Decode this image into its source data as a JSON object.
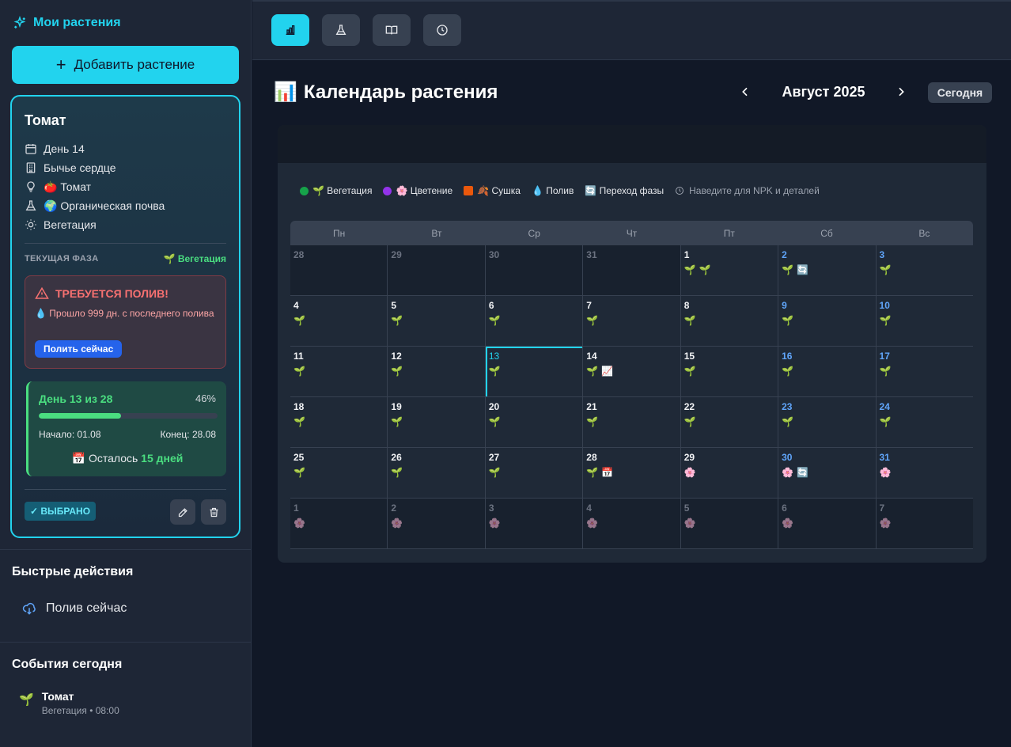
{
  "sidebar": {
    "brand": "Мои растения",
    "add_button": "Добавить растение",
    "plant": {
      "name": "Томат",
      "info": [
        {
          "icon": "calendar-icon",
          "text": "День 14"
        },
        {
          "icon": "building-icon",
          "text": "Бычье сердце"
        },
        {
          "icon": "lightbulb-icon",
          "text": "🍅 Томат"
        },
        {
          "icon": "flask-icon",
          "text": "🌍 Органическая почва"
        },
        {
          "icon": "sun-icon",
          "text": "Вегетация"
        }
      ],
      "phase_label": "ТЕКУЩАЯ ФАЗА",
      "phase_value": "🌱 Вегетация",
      "alert": {
        "title": "ТРЕБУЕТСЯ ПОЛИВ!",
        "text": "💧 Прошло 999 дн. с последнего полива",
        "button": "Полить сейчас"
      },
      "progress": {
        "day_text": "День 13 из 28",
        "percent_text": "46%",
        "percent": 46,
        "start": "Начало: 01.08",
        "end": "Конец: 28.08",
        "remaining_prefix": "Осталось",
        "remaining_value": "15 дней"
      },
      "selected_badge": "✓ ВЫБРАНО"
    },
    "quick_actions_title": "Быстрые действия",
    "quick_action": "Полив сейчас",
    "events_title": "События сегодня",
    "event": {
      "title": "Томат",
      "subtitle": "Вегетация • 08:00"
    }
  },
  "main": {
    "title": "Календарь растения",
    "month": "Август 2025",
    "today_button": "Сегодня",
    "legend": [
      {
        "color": "#16a34a",
        "shape": "dot",
        "label": "🌱 Вегетация"
      },
      {
        "color": "#9333ea",
        "shape": "dot",
        "label": "🌸 Цветение"
      },
      {
        "color": "#ea580c",
        "shape": "square",
        "label": "🍂 Сушка"
      },
      {
        "color": "",
        "shape": "none",
        "label": "💧 Полив"
      },
      {
        "color": "",
        "shape": "none",
        "label": "🔄 Переход фазы"
      }
    ],
    "legend_hint": "Наведите для NPK и деталей",
    "weekdays": [
      "Пн",
      "Вт",
      "Ср",
      "Чт",
      "Пт",
      "Сб",
      "Вс"
    ],
    "weeks": [
      [
        {
          "d": "28",
          "o": true,
          "i": ""
        },
        {
          "d": "29",
          "o": true,
          "i": ""
        },
        {
          "d": "30",
          "o": true,
          "i": ""
        },
        {
          "d": "31",
          "o": true,
          "i": ""
        },
        {
          "d": "1",
          "i": "🌱🌱"
        },
        {
          "d": "2",
          "i": "🌱🔄"
        },
        {
          "d": "3",
          "i": "🌱"
        }
      ],
      [
        {
          "d": "4",
          "i": "🌱"
        },
        {
          "d": "5",
          "i": "🌱"
        },
        {
          "d": "6",
          "i": "🌱"
        },
        {
          "d": "7",
          "i": "🌱"
        },
        {
          "d": "8",
          "i": "🌱"
        },
        {
          "d": "9",
          "i": "🌱"
        },
        {
          "d": "10",
          "i": "🌱"
        }
      ],
      [
        {
          "d": "11",
          "i": "🌱"
        },
        {
          "d": "12",
          "i": "🌱"
        },
        {
          "d": "13",
          "i": "🌱",
          "t": true
        },
        {
          "d": "14",
          "i": "🌱📈"
        },
        {
          "d": "15",
          "i": "🌱"
        },
        {
          "d": "16",
          "i": "🌱"
        },
        {
          "d": "17",
          "i": "🌱"
        }
      ],
      [
        {
          "d": "18",
          "i": "🌱"
        },
        {
          "d": "19",
          "i": "🌱"
        },
        {
          "d": "20",
          "i": "🌱"
        },
        {
          "d": "21",
          "i": "🌱"
        },
        {
          "d": "22",
          "i": "🌱"
        },
        {
          "d": "23",
          "i": "🌱"
        },
        {
          "d": "24",
          "i": "🌱"
        }
      ],
      [
        {
          "d": "25",
          "i": "🌱"
        },
        {
          "d": "26",
          "i": "🌱"
        },
        {
          "d": "27",
          "i": "🌱"
        },
        {
          "d": "28",
          "i": "🌱📅"
        },
        {
          "d": "29",
          "i": "🌸"
        },
        {
          "d": "30",
          "i": "🌸🔄"
        },
        {
          "d": "31",
          "i": "🌸"
        }
      ],
      [
        {
          "d": "1",
          "o": true,
          "i": "🌸"
        },
        {
          "d": "2",
          "o": true,
          "i": "🌸"
        },
        {
          "d": "3",
          "o": true,
          "i": "🌸"
        },
        {
          "d": "4",
          "o": true,
          "i": "🌸"
        },
        {
          "d": "5",
          "o": true,
          "i": "🌸"
        },
        {
          "d": "6",
          "o": true,
          "i": "🌸"
        },
        {
          "d": "7",
          "o": true,
          "i": "🌸"
        }
      ]
    ]
  },
  "colors": {
    "accent": "#22d3ee",
    "success": "#4ade80",
    "danger": "#f87171",
    "weekend": "#60a5fa"
  }
}
